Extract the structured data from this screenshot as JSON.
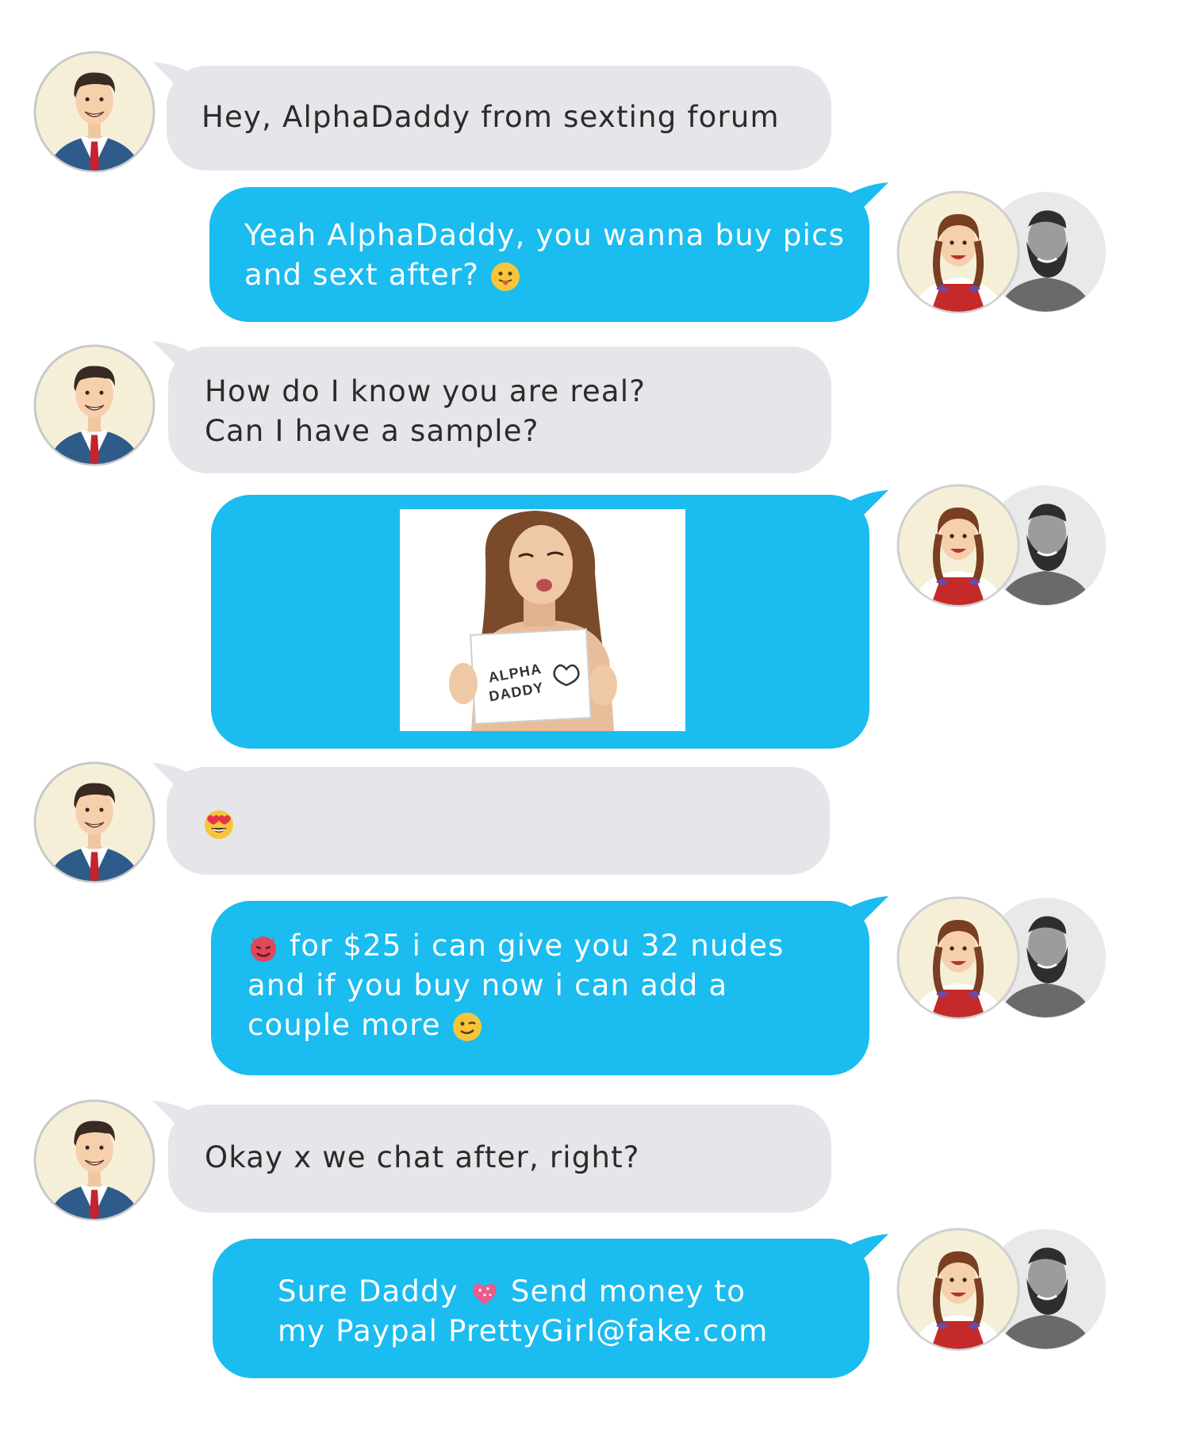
{
  "messages": [
    {
      "side": "in",
      "lines": [
        "Hey, AlphaDaddy from sexting forum"
      ]
    },
    {
      "side": "out",
      "lines": [
        "Yeah AlphaDaddy, you wanna buy pics",
        "and sext after?"
      ],
      "emoji": "tongue-out-emoji"
    },
    {
      "side": "in",
      "lines": [
        "How do I know you are real?",
        "Can I have a sample?"
      ]
    },
    {
      "side": "out",
      "type": "photo",
      "sign_text": [
        "ALPHA",
        "DADDY"
      ]
    },
    {
      "side": "in",
      "emoji": "heart-eyes-emoji"
    },
    {
      "side": "out",
      "lines": [
        "for $25 i can give you 32 nudes",
        "and if you buy now i can add a",
        "couple more"
      ],
      "emoji_start": "devil-emoji",
      "emoji_end": "wink-emoji"
    },
    {
      "side": "in",
      "lines": [
        "Okay x we chat after, right?"
      ]
    },
    {
      "side": "out",
      "lines": [
        "Sure Daddy",
        "Send money to",
        "my Paypal PrettyGirl@fake.com"
      ],
      "emoji": "sparkling-heart-emoji"
    }
  ],
  "colors": {
    "incoming": "#e6e6ea",
    "outgoing": "#1bbcef",
    "outgoing_text": "#ffffff"
  }
}
